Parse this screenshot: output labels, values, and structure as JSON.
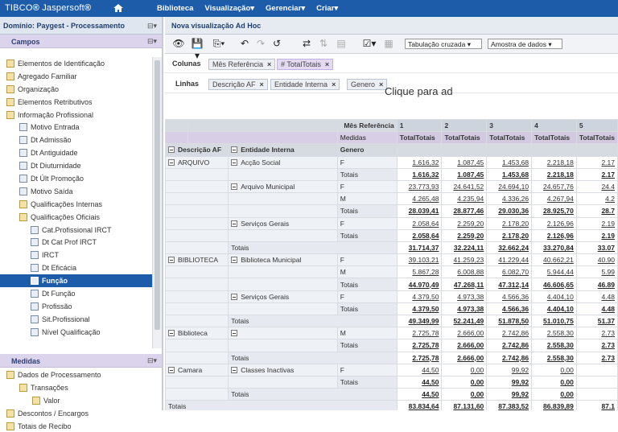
{
  "topbar": {
    "logo_main": "TIBCO",
    "logo_sub": "Jaspersoft",
    "nav": [
      "Biblioteca",
      "Visualização",
      "Gerenciar",
      "Criar"
    ]
  },
  "domain": {
    "label": "Domínio: Paygest - Processamento"
  },
  "fields": {
    "title": "Campos",
    "items": [
      {
        "label": "Elementos de Identificação",
        "indent": 1,
        "icon": "table-icon"
      },
      {
        "label": "Agregado Familiar",
        "indent": 1,
        "icon": "table-icon"
      },
      {
        "label": "Organização",
        "indent": 1,
        "icon": "table-icon"
      },
      {
        "label": "Elementos Retributivos",
        "indent": 1,
        "icon": "table-icon"
      },
      {
        "label": "Informação Profissional",
        "indent": 1,
        "icon": "table-icon"
      },
      {
        "label": "Motivo Entrada",
        "indent": 2,
        "icon": "field-icon"
      },
      {
        "label": "Dt Admissão",
        "indent": 2,
        "icon": "field-icon"
      },
      {
        "label": "Dt Antiguidade",
        "indent": 2,
        "icon": "field-icon"
      },
      {
        "label": "Dt Diuturnidade",
        "indent": 2,
        "icon": "field-icon"
      },
      {
        "label": "Dt Últ Promoção",
        "indent": 2,
        "icon": "field-icon"
      },
      {
        "label": "Motivo Saída",
        "indent": 2,
        "icon": "field-icon"
      },
      {
        "label": "Qualificações Internas",
        "indent": 2,
        "icon": "table-icon"
      },
      {
        "label": "Qualificações Oficiais",
        "indent": 2,
        "icon": "table-icon"
      },
      {
        "label": "Cat.Profissional IRCT",
        "indent": 3,
        "icon": "field-icon"
      },
      {
        "label": "Dt Cat Prof IRCT",
        "indent": 3,
        "icon": "field-icon"
      },
      {
        "label": "IRCT",
        "indent": 3,
        "icon": "field-icon"
      },
      {
        "label": "Dt Eficácia",
        "indent": 3,
        "icon": "field-icon"
      },
      {
        "label": "Função",
        "indent": 3,
        "icon": "field-icon",
        "selected": true
      },
      {
        "label": "Dt Função",
        "indent": 3,
        "icon": "field-icon"
      },
      {
        "label": "Profissão",
        "indent": 3,
        "icon": "field-icon"
      },
      {
        "label": "Sit.Profissional",
        "indent": 3,
        "icon": "field-icon"
      },
      {
        "label": "Nível Qualificação",
        "indent": 3,
        "icon": "field-icon"
      }
    ]
  },
  "measures": {
    "title": "Medidas",
    "items": [
      {
        "label": "Dados de Processamento",
        "indent": 1
      },
      {
        "label": "Transações",
        "indent": 2
      },
      {
        "label": "Valor",
        "indent": 3
      },
      {
        "label": "Descontos / Encargos",
        "indent": 1
      },
      {
        "label": "Totais de Recibo",
        "indent": 1
      }
    ]
  },
  "main": {
    "title": "Nova visualização Ad Hoc",
    "view_select": "Tabulação cruzada",
    "data_select": "Amostra de dados",
    "columns_label": "Colunas",
    "columns": [
      "Mês Referência",
      "TotalTotais"
    ],
    "rows_label": "Linhas",
    "rows": [
      "Descrição AF",
      "Entidade Interna",
      "Genero"
    ],
    "hint": "Clique para ad"
  },
  "grid": {
    "month_label": "Mês Referência",
    "measures_label": "Medidas",
    "months": [
      "1",
      "2",
      "3",
      "4",
      "5"
    ],
    "measure": "TotalTotais",
    "row_headers": [
      "Descrição AF",
      "Entidade Interna",
      "Genero"
    ],
    "totais": "Totais",
    "rows": [
      {
        "g": "ARQUIVO",
        "e": "Acção Social",
        "s": "F",
        "v": [
          "1.616,32",
          "1.087,45",
          "1.453,68",
          "2.218,18",
          "2.17"
        ]
      },
      {
        "s": "Totais",
        "t": true,
        "v": [
          "1.616,32",
          "1.087,45",
          "1.453,68",
          "2.218,18",
          "2.17"
        ]
      },
      {
        "e": "Arquivo Municipal",
        "s": "F",
        "v": [
          "23.773,93",
          "24.641,52",
          "24.694,10",
          "24.657,76",
          "24.4"
        ]
      },
      {
        "s": "M",
        "v": [
          "4.265,48",
          "4.235,94",
          "4.336,26",
          "4.267,94",
          "4.2"
        ]
      },
      {
        "s": "Totais",
        "t": true,
        "v": [
          "28.039,41",
          "28.877,46",
          "29.030,36",
          "28.925,70",
          "28.7"
        ]
      },
      {
        "e": "Serviços Gerais",
        "s": "F",
        "v": [
          "2.058,64",
          "2.259,20",
          "2.178,20",
          "2.126,96",
          "2.19"
        ]
      },
      {
        "s": "Totais",
        "t": true,
        "v": [
          "2.058,64",
          "2.259,20",
          "2.178,20",
          "2.126,96",
          "2.19"
        ]
      },
      {
        "e": "Totais",
        "tt": true,
        "v": [
          "31.714,37",
          "32.224,11",
          "32.662,24",
          "33.270,84",
          "33.07"
        ]
      },
      {
        "g": "BIBLIOTECA",
        "e": "Biblioteca Municipal",
        "s": "F",
        "v": [
          "39.103,21",
          "41.259,23",
          "41.229,44",
          "40.662,21",
          "40.90"
        ]
      },
      {
        "s": "M",
        "v": [
          "5.867,28",
          "6.008,88",
          "6.082,70",
          "5.944,44",
          "5.99"
        ]
      },
      {
        "s": "Totais",
        "t": true,
        "v": [
          "44.970,49",
          "47.268,11",
          "47.312,14",
          "46.606,65",
          "46.89"
        ]
      },
      {
        "e": "Serviços Gerais",
        "s": "F",
        "v": [
          "4.379,50",
          "4.973,38",
          "4.566,36",
          "4.404,10",
          "4.48"
        ]
      },
      {
        "s": "Totais",
        "t": true,
        "v": [
          "4.379,50",
          "4.973,38",
          "4.566,36",
          "4.404,10",
          "4.48"
        ]
      },
      {
        "e": "Totais",
        "tt": true,
        "v": [
          "49.349,99",
          "52.241,49",
          "51.878,50",
          "51.010,75",
          "51.37"
        ]
      },
      {
        "g": "Biblioteca",
        "e": "",
        "s": "M",
        "v": [
          "2.725,78",
          "2.666,00",
          "2.742,86",
          "2.558,30",
          "2.73"
        ]
      },
      {
        "s": "Totais",
        "t": true,
        "v": [
          "2.725,78",
          "2.666,00",
          "2.742,86",
          "2.558,30",
          "2.73"
        ]
      },
      {
        "e": "Totais",
        "tt": true,
        "v": [
          "2.725,78",
          "2.666,00",
          "2.742,86",
          "2.558,30",
          "2.73"
        ]
      },
      {
        "g": "Camara",
        "e": "Classes Inactivas",
        "s": "F",
        "v": [
          "44,50",
          "0,00",
          "99,92",
          "0,00",
          ""
        ]
      },
      {
        "s": "Totais",
        "t": true,
        "v": [
          "44,50",
          "0,00",
          "99,92",
          "0,00",
          ""
        ]
      },
      {
        "e": "Totais",
        "tt": true,
        "v": [
          "44,50",
          "0,00",
          "99,92",
          "0,00",
          ""
        ]
      },
      {
        "g": "Totais",
        "gt": true,
        "v": [
          "83.834,64",
          "87.131,60",
          "87.383,52",
          "86.839,89",
          "87.1"
        ]
      }
    ]
  }
}
